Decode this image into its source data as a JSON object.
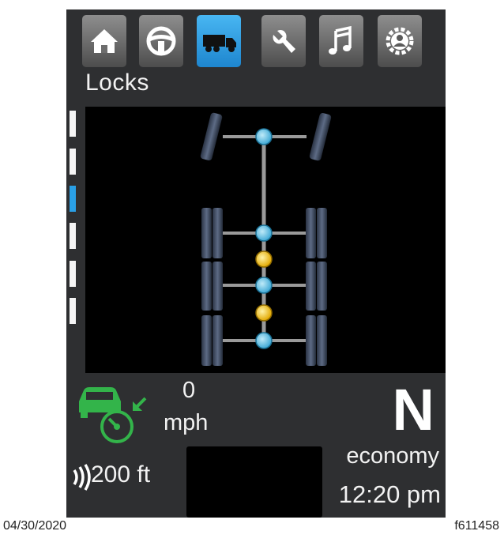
{
  "screen_title": "Locks",
  "tabs": [
    {
      "icon": "home-icon",
      "active": false
    },
    {
      "icon": "steering-wheel-icon",
      "active": false
    },
    {
      "icon": "truck-icon",
      "active": true
    },
    {
      "icon": "wrench-icon",
      "active": false
    },
    {
      "icon": "music-note-icon",
      "active": false
    },
    {
      "icon": "driver-profile-gear-icon",
      "active": false
    }
  ],
  "page_indicator": {
    "count": 6,
    "active_index": 2
  },
  "axles": [
    {
      "name": "steer",
      "lock": "unlocked"
    },
    {
      "name": "rear-1",
      "lock": "unlocked"
    },
    {
      "name": "inter-axle-1",
      "lock": "engaged"
    },
    {
      "name": "rear-2",
      "lock": "unlocked"
    },
    {
      "name": "inter-axle-2",
      "lock": "engaged"
    },
    {
      "name": "rear-3",
      "lock": "unlocked"
    }
  ],
  "speed": {
    "value": "0",
    "unit": "mph"
  },
  "gear": "N",
  "drive_mode": "economy",
  "clock": "12:20 pm",
  "following_distance": "200 ft",
  "footer": {
    "date": "04/30/2020",
    "figure_id": "f611458"
  },
  "colors": {
    "panel": "#2e2f31",
    "tab_active": "#2aa0e6",
    "lock_engaged": "#e6b422",
    "lock_disengaged": "#6cc6e8",
    "cruise_icon": "#33b44a"
  }
}
